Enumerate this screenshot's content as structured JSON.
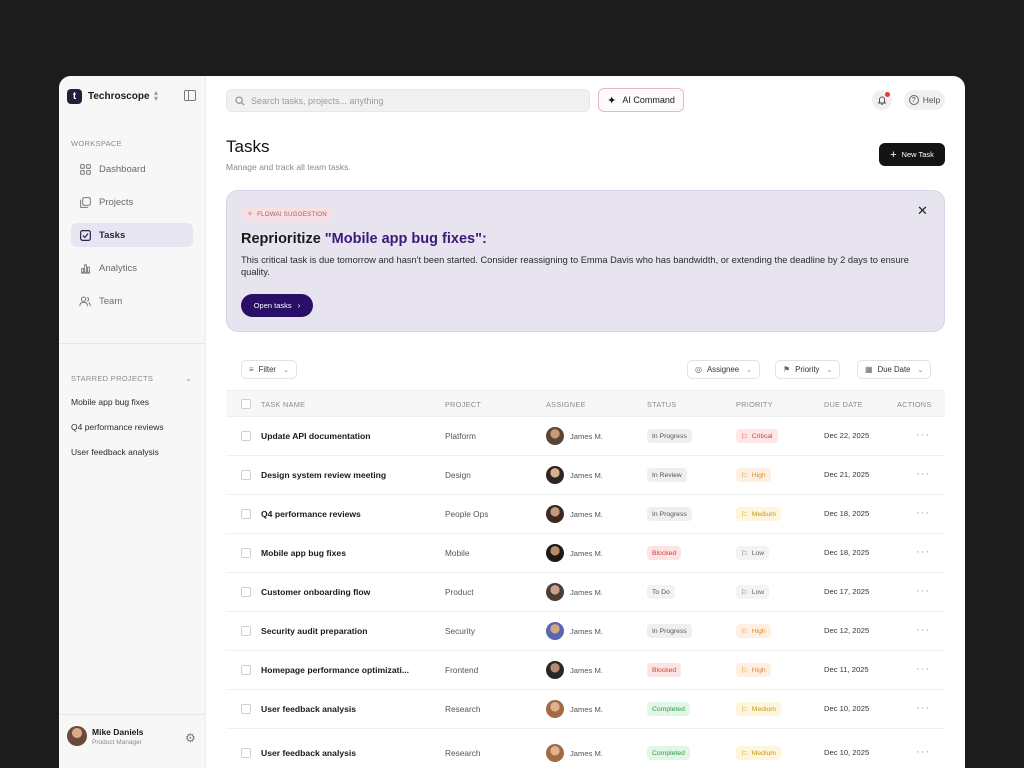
{
  "app": {
    "brand_name": "Techroscope",
    "brand_letter": "t"
  },
  "sidebar": {
    "workspace_label": "WORKSPACE",
    "nav": [
      {
        "label": "Dashboard",
        "icon": "dashboard-icon"
      },
      {
        "label": "Projects",
        "icon": "projects-icon"
      },
      {
        "label": "Tasks",
        "icon": "tasks-icon",
        "active": true
      },
      {
        "label": "Analytics",
        "icon": "analytics-icon"
      },
      {
        "label": "Team",
        "icon": "team-icon"
      }
    ],
    "starred_label": "STARRED PROJECTS",
    "starred": [
      "Mobile app bug fixes",
      "Q4 performance reviews",
      "User feedback analysis"
    ],
    "user": {
      "name": "Mike Daniels",
      "role": "Product Manager"
    }
  },
  "topbar": {
    "search_placeholder": "Search tasks, projects... anything",
    "ai_label": "AI Command",
    "help_label": "Help"
  },
  "page": {
    "title": "Tasks",
    "subtitle": "Manage and track all team tasks.",
    "new_task_label": "New Task"
  },
  "suggestion": {
    "tag": "FLOWAI SUGGESTION",
    "title_prefix": "Reprioritize ",
    "title_highlight": "\"Mobile app bug fixes\":",
    "body": "This critical task is due tomorrow and hasn't been started. Consider reassigning to Emma Davis who has bandwidth, or extending the deadline by 2 days to ensure quality.",
    "button_label": "Open tasks"
  },
  "toolbar": {
    "filter_label": "Filter",
    "assignee_label": "Assignee",
    "priority_label": "Priority",
    "due_date_label": "Due Date"
  },
  "table": {
    "headers": {
      "task_name": "TASK NAME",
      "project": "PROJECT",
      "assignee": "ASSIGNEE",
      "status": "STATUS",
      "priority": "PRIORITY",
      "due_date": "DUE DATE",
      "actions": "ACTIONS"
    },
    "rows": [
      {
        "name": "Update API documentation",
        "project": "Platform",
        "assignee": "James M.",
        "status": "In Progress",
        "priority": "Critical",
        "due": "Dec 22, 2025"
      },
      {
        "name": "Design system review meeting",
        "project": "Design",
        "assignee": "James M.",
        "status": "In Review",
        "priority": "High",
        "due": "Dec 21, 2025"
      },
      {
        "name": "Q4 performance reviews",
        "project": "People Ops",
        "assignee": "James M.",
        "status": "In Progress",
        "priority": "Medium",
        "due": "Dec 18, 2025"
      },
      {
        "name": "Mobile app bug fixes",
        "project": "Mobile",
        "assignee": "James M.",
        "status": "Blocked",
        "priority": "Low",
        "due": "Dec 18, 2025"
      },
      {
        "name": "Customer onboarding flow",
        "project": "Product",
        "assignee": "James M.",
        "status": "To Do",
        "priority": "Low",
        "due": "Dec 17, 2025"
      },
      {
        "name": "Security audit preparation",
        "project": "Security",
        "assignee": "James M.",
        "status": "In Progress",
        "priority": "High",
        "due": "Dec 12, 2025"
      },
      {
        "name": "Homepage performance optimizati...",
        "project": "Frontend",
        "assignee": "James M.",
        "status": "Blocked",
        "priority": "High",
        "due": "Dec 11, 2025"
      },
      {
        "name": "User feedback analysis",
        "project": "Research",
        "assignee": "James M.",
        "status": "Completed",
        "priority": "Medium",
        "due": "Dec 10, 2025"
      },
      {
        "name": "User feedback analysis",
        "project": "Research",
        "assignee": "James M.",
        "status": "Completed",
        "priority": "Medium",
        "due": "Dec 10, 2025"
      }
    ]
  },
  "colors": {
    "accent": "#2a0f68",
    "status": {
      "In Progress": {
        "bg": "#efefef",
        "fg": "#555555"
      },
      "In Review": {
        "bg": "#efefef",
        "fg": "#555555"
      },
      "Blocked": {
        "bg": "#fde4e4",
        "fg": "#d13b3b"
      },
      "To Do": {
        "bg": "#f2f2f2",
        "fg": "#555555"
      },
      "Completed": {
        "bg": "#e2f6e6",
        "fg": "#2e9a4c"
      }
    },
    "priority": {
      "Critical": {
        "bg": "#fde7e7",
        "fg": "#d14040"
      },
      "High": {
        "bg": "#fdf0e2",
        "fg": "#e08a2c"
      },
      "Medium": {
        "bg": "#fdf6dc",
        "fg": "#c59a12"
      },
      "Low": {
        "bg": "#f3f3f3",
        "fg": "#666666"
      }
    }
  }
}
